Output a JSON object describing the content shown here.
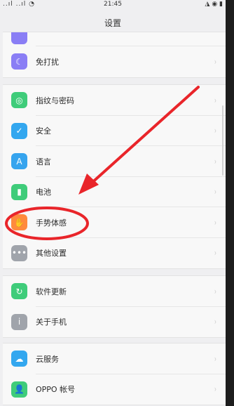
{
  "status": {
    "left": "..ıl ..ıl ◔",
    "time": "21:45",
    "right": "◮ ◉ ▮"
  },
  "header": {
    "title": "设置"
  },
  "groups": [
    {
      "rows": [
        {
          "label": "",
          "icon": "settings-icon",
          "color": "#8a7ef5"
        },
        {
          "label": "免打扰",
          "icon": "moon-icon",
          "color": "#8a7ef5"
        }
      ]
    },
    {
      "rows": [
        {
          "label": "指纹与密码",
          "icon": "fingerprint-icon",
          "color": "#3fcc7a"
        },
        {
          "label": "安全",
          "icon": "shield-icon",
          "color": "#33a7ef"
        },
        {
          "label": "语言",
          "icon": "language-icon",
          "color": "#36a4ee"
        },
        {
          "label": "电池",
          "icon": "battery-icon",
          "color": "#3fcc7a"
        },
        {
          "label": "手势体感",
          "icon": "gesture-icon",
          "color": "#ff8a3d"
        },
        {
          "label": "其他设置",
          "icon": "more-icon",
          "color": "#a0a4ab"
        }
      ]
    },
    {
      "rows": [
        {
          "label": "软件更新",
          "icon": "update-icon",
          "color": "#3fcc7a"
        },
        {
          "label": "关于手机",
          "icon": "info-icon",
          "color": "#a0a4ab"
        }
      ]
    },
    {
      "rows": [
        {
          "label": "云服务",
          "icon": "cloud-icon",
          "color": "#33a7ef"
        },
        {
          "label": "OPPO 帐号",
          "icon": "account-icon",
          "color": "#3fcc7a"
        }
      ]
    }
  ],
  "chevron": "›"
}
